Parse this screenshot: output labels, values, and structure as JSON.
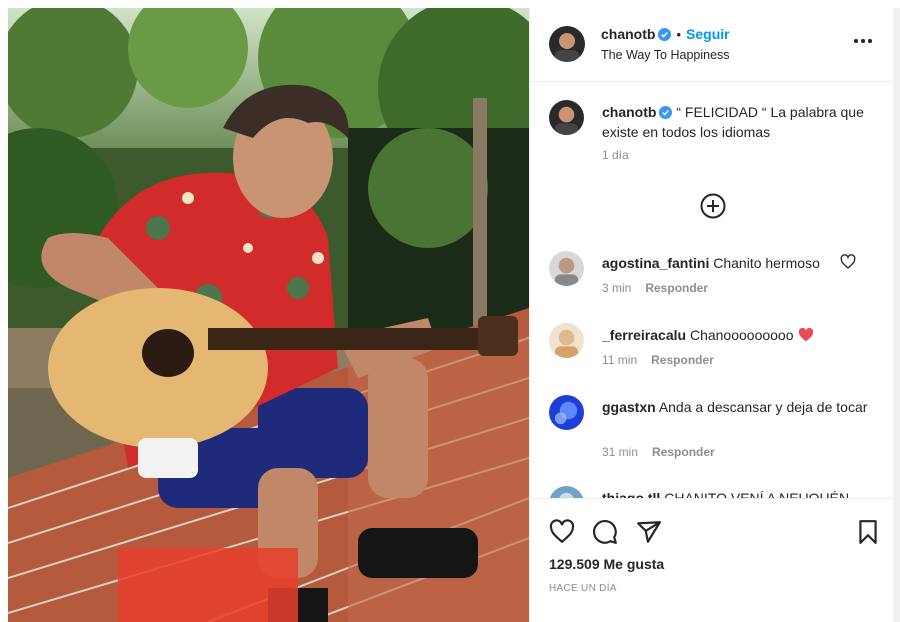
{
  "post": {
    "photo_alt": "Man in red floral shirt playing acoustic guitar sitting on brick wall"
  },
  "header": {
    "username": "chanotb",
    "separator": "•",
    "follow_label": "Seguir",
    "subtitle": "The Way To Happiness"
  },
  "caption": {
    "username": "chanotb",
    "text": "“ FELICIDAD “ La palabra que existe en todos los idiomas",
    "time": "1 día"
  },
  "comments": [
    {
      "username": "agostina_fantini",
      "text": "Chanito hermoso",
      "time": "3 min",
      "reply": "Responder"
    },
    {
      "username": "_ferreiracalu",
      "text": "Chanooooooooo",
      "time": "11 min",
      "reply": "Responder"
    },
    {
      "username": "ggastxn",
      "text": "Anda a descansar y deja de tocar",
      "time": "31 min",
      "reply": "Responder"
    },
    {
      "username": "thiago.tll",
      "text": "CHANITO VENÍ A NEUQUÉN",
      "time": "",
      "reply": ""
    }
  ],
  "actions": {
    "likes": "129.509 Me gusta",
    "posted": "HACE UN DÍA"
  },
  "colors": {
    "accent": "#0095f6",
    "heart_red": "#ed4956",
    "verified": "#3897f0"
  }
}
